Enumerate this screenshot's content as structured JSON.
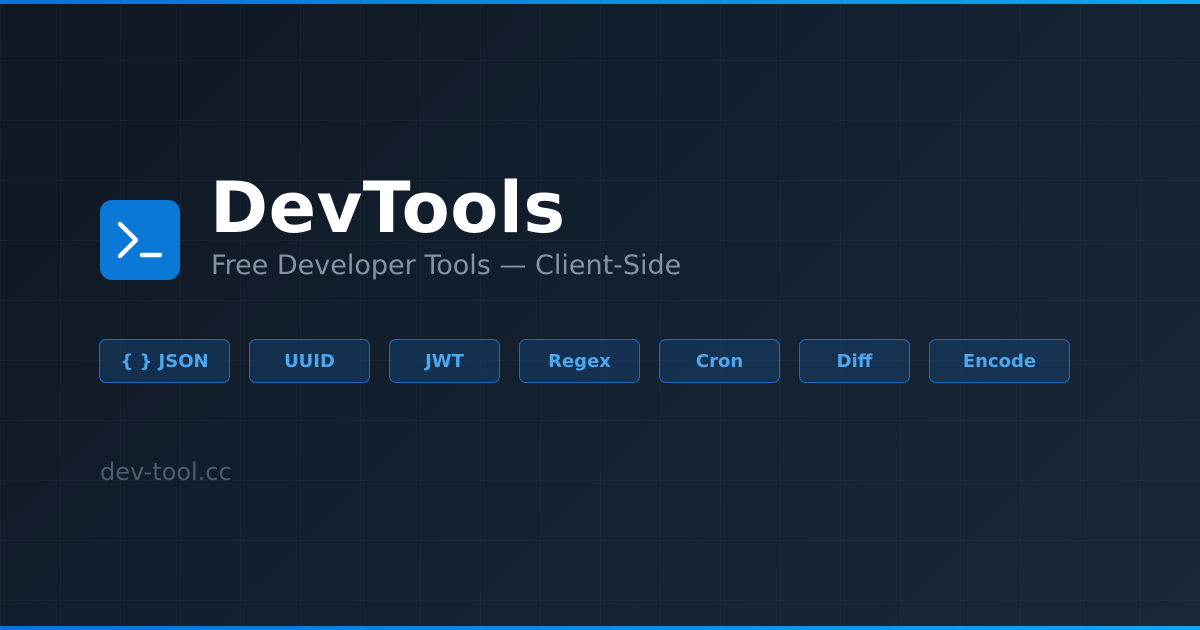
{
  "brand": {
    "title": "DevTools",
    "subtitle": "Free Developer Tools — Client-Side",
    "logo_icon": "terminal-prompt-icon",
    "domain": "dev-tool.cc"
  },
  "tools": [
    {
      "label": "{ } JSON"
    },
    {
      "label": "UUID"
    },
    {
      "label": "JWT"
    },
    {
      "label": "Regex"
    },
    {
      "label": "Cron"
    },
    {
      "label": "Diff"
    },
    {
      "label": "Encode"
    }
  ],
  "colors": {
    "background": "#111a25",
    "accent": "#0978d6",
    "accent_bar": "#12a6ee",
    "pill_text": "#4fa6ee",
    "pill_border": "#1d6cc0",
    "title": "#ffffff",
    "subtitle": "#8592a3",
    "domain": "#4e5b6b"
  }
}
